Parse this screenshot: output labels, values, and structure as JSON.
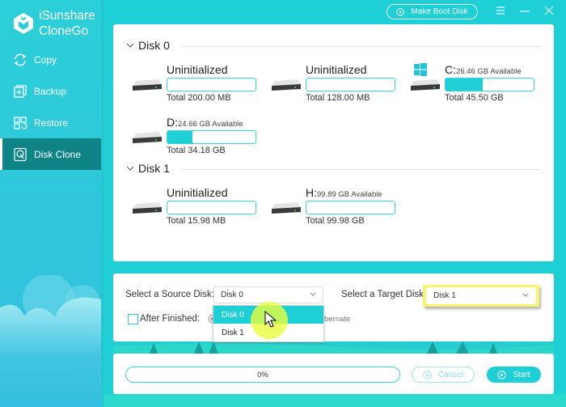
{
  "app": {
    "title_line1": "iSunshare",
    "title_line2": "CloneGo"
  },
  "sidebar": {
    "items": [
      {
        "label": "Copy",
        "icon": "sync-icon",
        "active": false
      },
      {
        "label": "Backup",
        "icon": "backup-icon",
        "active": false
      },
      {
        "label": "Restore",
        "icon": "restore-icon",
        "active": false
      },
      {
        "label": "Disk Clone",
        "icon": "disk-clone-icon",
        "active": true
      }
    ]
  },
  "topbar": {
    "boot_label": "Make Boot Disk",
    "menu_icon": "menu-icon",
    "minimize_icon": "minimize-icon",
    "close_icon": "close-icon"
  },
  "disks": [
    {
      "label": "Disk 0",
      "partitions": [
        {
          "name": "Uninitialized",
          "available": "",
          "total": "Total 200.00 MB",
          "used_fraction": 0,
          "system": false
        },
        {
          "name": "Uninitialized",
          "available": "",
          "total": "Total 128.00 MB",
          "used_fraction": 0,
          "system": false
        },
        {
          "name": "C:",
          "available": "26.46 GB Available",
          "total": "Total 45.50 GB",
          "used_fraction": 0.42,
          "system": true
        },
        {
          "name": "D:",
          "available": "24.66 GB Available",
          "total": "Total 34.18 GB",
          "used_fraction": 0.28,
          "system": false
        }
      ]
    },
    {
      "label": "Disk 1",
      "partitions": [
        {
          "name": "Uninitialized",
          "available": "",
          "total": "Total 15.98 MB",
          "used_fraction": 0,
          "system": false
        },
        {
          "name": "H:",
          "available": "99.89 GB Available",
          "total": "Total 99.98 GB",
          "used_fraction": 0,
          "system": false
        }
      ]
    }
  ],
  "options": {
    "source_label": "Select a Source Disk:",
    "source_value": "Disk 0",
    "source_options": [
      "Disk 0",
      "Disk 1"
    ],
    "target_label": "Select a Target Disk:",
    "target_value": "Disk 1",
    "after_finished_label": "After Finished:",
    "after_finished_checked": false,
    "hibernate_fragment": "bernate"
  },
  "run": {
    "progress_text": "0%",
    "progress": 0,
    "cancel_label": "Cancel",
    "start_label": "Start"
  },
  "colors": {
    "accent": "#1ecfd6",
    "sidebar_active": "#0f8486",
    "highlight": "#f8f56a"
  }
}
